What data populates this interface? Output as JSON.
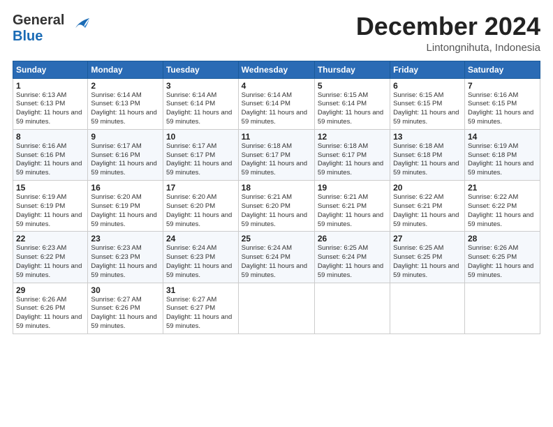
{
  "header": {
    "logo_line1": "General",
    "logo_line2": "Blue",
    "month": "December 2024",
    "location": "Lintongnihuta, Indonesia"
  },
  "days_of_week": [
    "Sunday",
    "Monday",
    "Tuesday",
    "Wednesday",
    "Thursday",
    "Friday",
    "Saturday"
  ],
  "weeks": [
    [
      {
        "day": 1,
        "sunrise": "6:13 AM",
        "sunset": "6:13 PM",
        "daylight": "11 hours and 59 minutes."
      },
      {
        "day": 2,
        "sunrise": "6:14 AM",
        "sunset": "6:13 PM",
        "daylight": "11 hours and 59 minutes."
      },
      {
        "day": 3,
        "sunrise": "6:14 AM",
        "sunset": "6:14 PM",
        "daylight": "11 hours and 59 minutes."
      },
      {
        "day": 4,
        "sunrise": "6:14 AM",
        "sunset": "6:14 PM",
        "daylight": "11 hours and 59 minutes."
      },
      {
        "day": 5,
        "sunrise": "6:15 AM",
        "sunset": "6:14 PM",
        "daylight": "11 hours and 59 minutes."
      },
      {
        "day": 6,
        "sunrise": "6:15 AM",
        "sunset": "6:15 PM",
        "daylight": "11 hours and 59 minutes."
      },
      {
        "day": 7,
        "sunrise": "6:16 AM",
        "sunset": "6:15 PM",
        "daylight": "11 hours and 59 minutes."
      }
    ],
    [
      {
        "day": 8,
        "sunrise": "6:16 AM",
        "sunset": "6:16 PM",
        "daylight": "11 hours and 59 minutes."
      },
      {
        "day": 9,
        "sunrise": "6:17 AM",
        "sunset": "6:16 PM",
        "daylight": "11 hours and 59 minutes."
      },
      {
        "day": 10,
        "sunrise": "6:17 AM",
        "sunset": "6:17 PM",
        "daylight": "11 hours and 59 minutes."
      },
      {
        "day": 11,
        "sunrise": "6:18 AM",
        "sunset": "6:17 PM",
        "daylight": "11 hours and 59 minutes."
      },
      {
        "day": 12,
        "sunrise": "6:18 AM",
        "sunset": "6:17 PM",
        "daylight": "11 hours and 59 minutes."
      },
      {
        "day": 13,
        "sunrise": "6:18 AM",
        "sunset": "6:18 PM",
        "daylight": "11 hours and 59 minutes."
      },
      {
        "day": 14,
        "sunrise": "6:19 AM",
        "sunset": "6:18 PM",
        "daylight": "11 hours and 59 minutes."
      }
    ],
    [
      {
        "day": 15,
        "sunrise": "6:19 AM",
        "sunset": "6:19 PM",
        "daylight": "11 hours and 59 minutes."
      },
      {
        "day": 16,
        "sunrise": "6:20 AM",
        "sunset": "6:19 PM",
        "daylight": "11 hours and 59 minutes."
      },
      {
        "day": 17,
        "sunrise": "6:20 AM",
        "sunset": "6:20 PM",
        "daylight": "11 hours and 59 minutes."
      },
      {
        "day": 18,
        "sunrise": "6:21 AM",
        "sunset": "6:20 PM",
        "daylight": "11 hours and 59 minutes."
      },
      {
        "day": 19,
        "sunrise": "6:21 AM",
        "sunset": "6:21 PM",
        "daylight": "11 hours and 59 minutes."
      },
      {
        "day": 20,
        "sunrise": "6:22 AM",
        "sunset": "6:21 PM",
        "daylight": "11 hours and 59 minutes."
      },
      {
        "day": 21,
        "sunrise": "6:22 AM",
        "sunset": "6:22 PM",
        "daylight": "11 hours and 59 minutes."
      }
    ],
    [
      {
        "day": 22,
        "sunrise": "6:23 AM",
        "sunset": "6:22 PM",
        "daylight": "11 hours and 59 minutes."
      },
      {
        "day": 23,
        "sunrise": "6:23 AM",
        "sunset": "6:23 PM",
        "daylight": "11 hours and 59 minutes."
      },
      {
        "day": 24,
        "sunrise": "6:24 AM",
        "sunset": "6:23 PM",
        "daylight": "11 hours and 59 minutes."
      },
      {
        "day": 25,
        "sunrise": "6:24 AM",
        "sunset": "6:24 PM",
        "daylight": "11 hours and 59 minutes."
      },
      {
        "day": 26,
        "sunrise": "6:25 AM",
        "sunset": "6:24 PM",
        "daylight": "11 hours and 59 minutes."
      },
      {
        "day": 27,
        "sunrise": "6:25 AM",
        "sunset": "6:25 PM",
        "daylight": "11 hours and 59 minutes."
      },
      {
        "day": 28,
        "sunrise": "6:26 AM",
        "sunset": "6:25 PM",
        "daylight": "11 hours and 59 minutes."
      }
    ],
    [
      {
        "day": 29,
        "sunrise": "6:26 AM",
        "sunset": "6:26 PM",
        "daylight": "11 hours and 59 minutes."
      },
      {
        "day": 30,
        "sunrise": "6:27 AM",
        "sunset": "6:26 PM",
        "daylight": "11 hours and 59 minutes."
      },
      {
        "day": 31,
        "sunrise": "6:27 AM",
        "sunset": "6:27 PM",
        "daylight": "11 hours and 59 minutes."
      },
      null,
      null,
      null,
      null
    ]
  ]
}
